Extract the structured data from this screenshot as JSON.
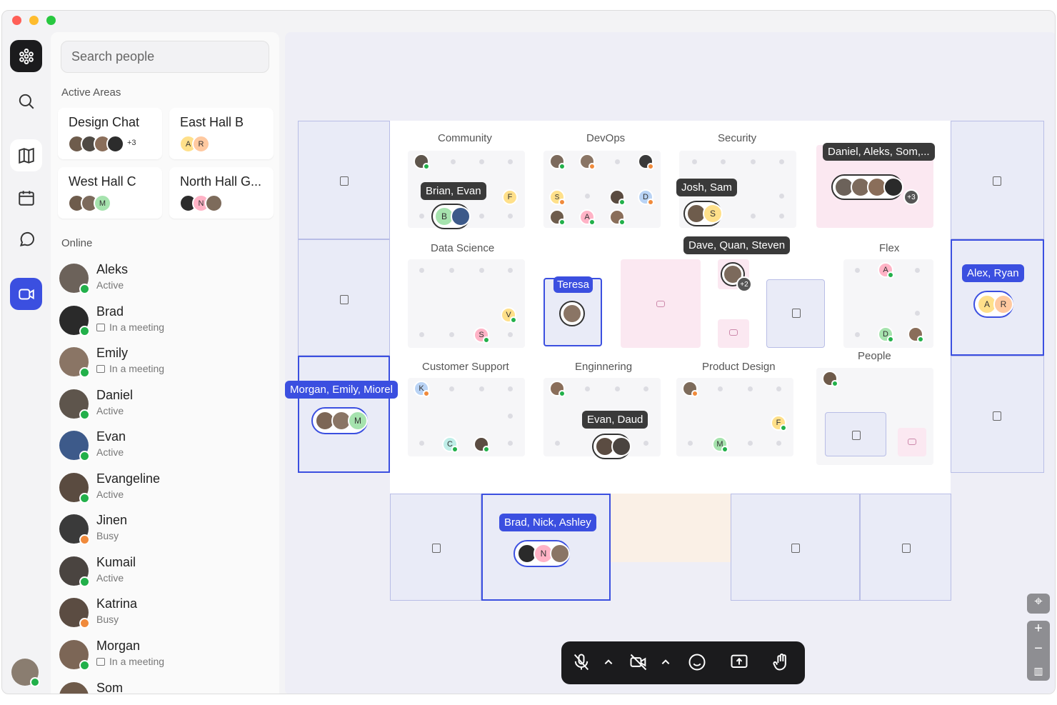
{
  "sidebar": {
    "search_placeholder": "Search people",
    "active_areas_title": "Active Areas",
    "online_title": "Online",
    "areas": [
      {
        "name": "Design Chat",
        "extra": "+3"
      },
      {
        "name": "East Hall B",
        "initials": [
          "A",
          "R"
        ]
      },
      {
        "name": "West Hall C",
        "initials": [
          "M"
        ]
      },
      {
        "name": "North Hall G...",
        "initials": [
          "N"
        ]
      }
    ],
    "people": [
      {
        "name": "Aleks",
        "status": "Active"
      },
      {
        "name": "Brad",
        "status": "In a meeting"
      },
      {
        "name": "Emily",
        "status": "In a meeting"
      },
      {
        "name": "Daniel",
        "status": "Active"
      },
      {
        "name": "Evan",
        "status": "Active"
      },
      {
        "name": "Evangeline",
        "status": "Active"
      },
      {
        "name": "Jinen",
        "status": "Busy"
      },
      {
        "name": "Kumail",
        "status": "Active"
      },
      {
        "name": "Katrina",
        "status": "Busy"
      },
      {
        "name": "Morgan",
        "status": "In a meeting"
      },
      {
        "name": "Som",
        "status": ""
      }
    ]
  },
  "map": {
    "rooms": [
      "Community",
      "DevOps",
      "Security",
      "Data Science",
      "Flex",
      "Customer Support",
      "Enginnering",
      "Product Design",
      "People"
    ],
    "tooltips": {
      "community": "Brian, Evan",
      "security": "Josh, Sam",
      "pink_room": "Daniel, Aleks, Som,...",
      "center": "Dave, Quan, Steven",
      "teresa": "Teresa",
      "alex_ryan": "Alex, Ryan",
      "morgan": "Morgan, Emily, Miorel",
      "engineering": "Evan, Daud",
      "brad": "Brad, Nick, Ashley"
    },
    "badges": {
      "pink_plus": "+3",
      "center_plus": "+2"
    },
    "initials": {
      "f": "F",
      "b": "B",
      "s": "S",
      "d": "D",
      "a": "A",
      "v": "V",
      "k": "K",
      "c": "C",
      "m": "M",
      "r": "R",
      "n": "N"
    }
  },
  "colors": {
    "accent": "#3b4fe0",
    "online": "#22b04a",
    "control_bar": "#1b1b1d"
  }
}
